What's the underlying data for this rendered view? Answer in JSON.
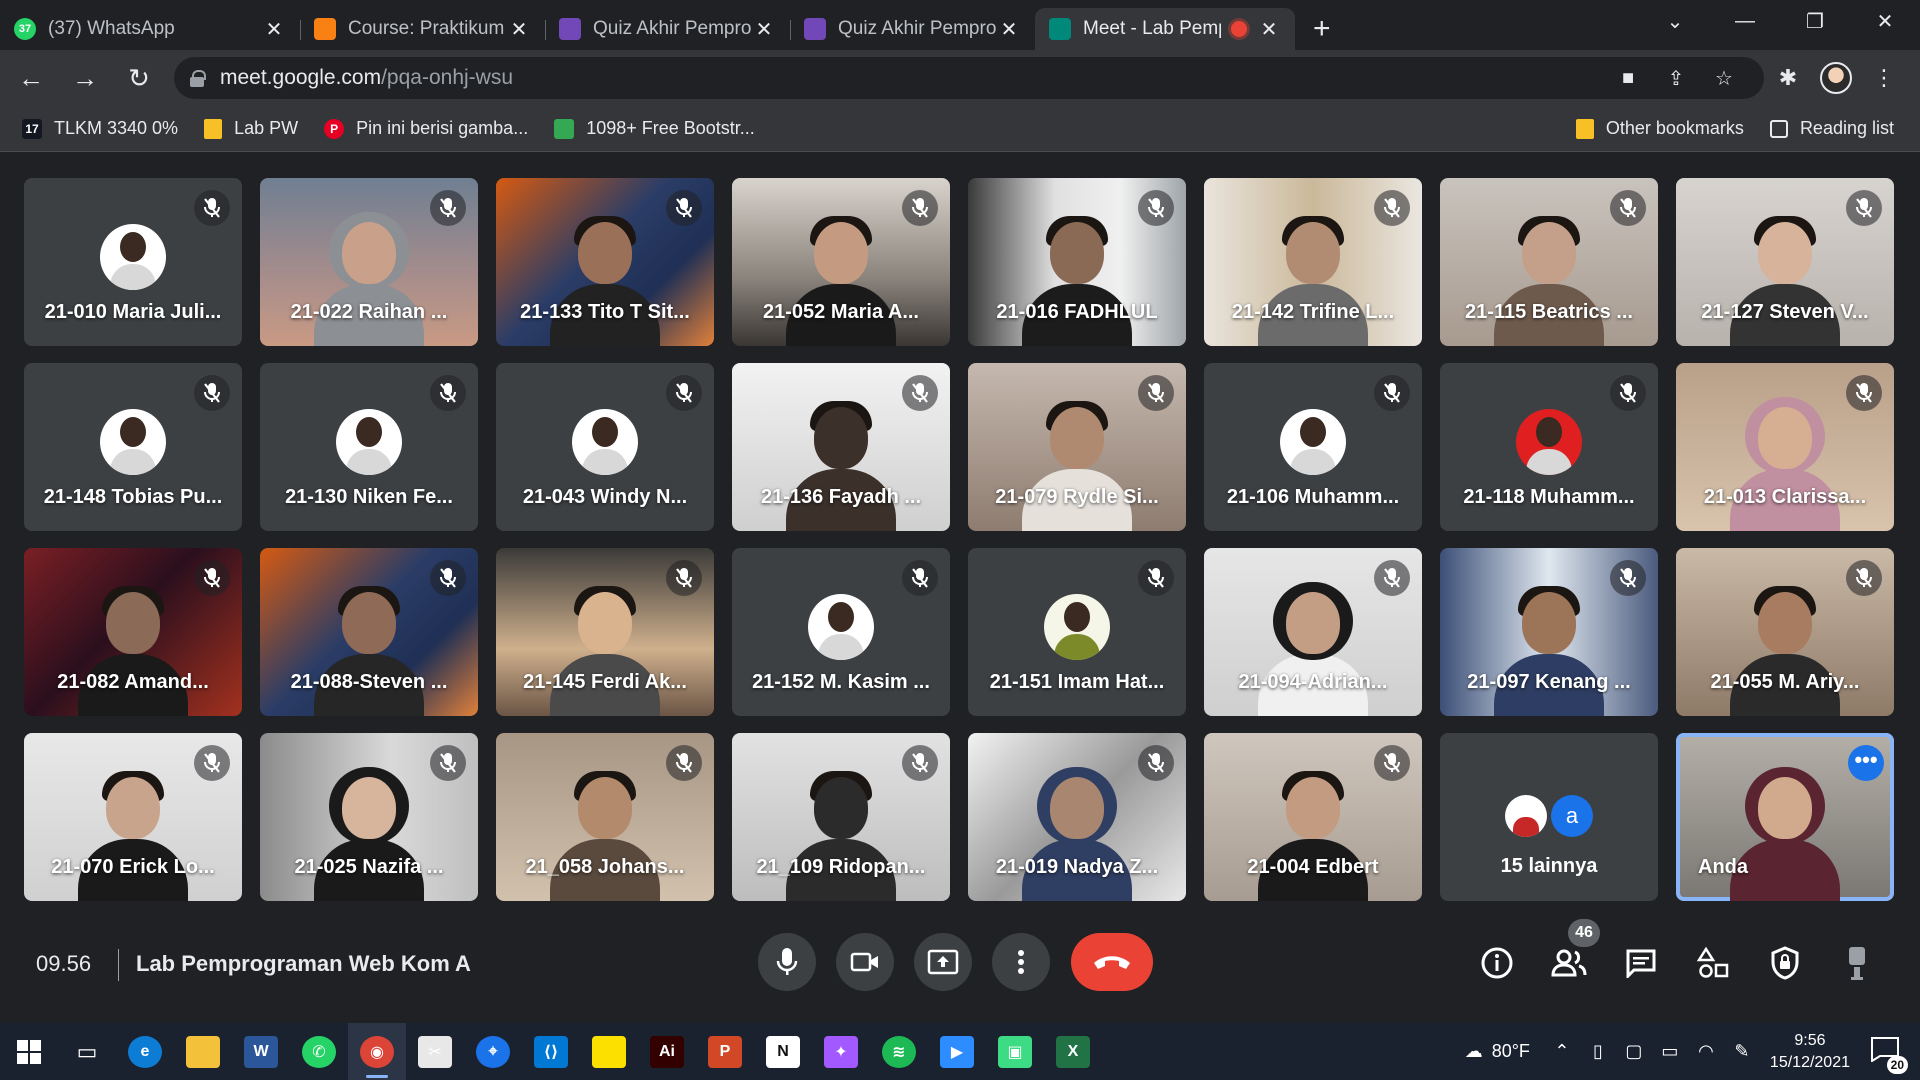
{
  "browser": {
    "tabs": [
      {
        "title": "(37) WhatsApp",
        "favicon": "whatsapp-icon",
        "color": "#25d366",
        "badge": "37",
        "active": false
      },
      {
        "title": "Course: Praktikum Pemrog",
        "favicon": "moodle-icon",
        "color": "#f98012",
        "active": false
      },
      {
        "title": "Quiz Akhir Pemprograma",
        "favicon": "forms-icon",
        "color": "#7248b9",
        "active": false
      },
      {
        "title": "Quiz Akhir Pemprograma",
        "favicon": "forms-icon",
        "color": "#7248b9",
        "active": false
      },
      {
        "title": "Meet - Lab Pemprogr",
        "favicon": "meet-icon",
        "color": "#00897b",
        "active": true,
        "recording": true
      }
    ],
    "url_host": "meet.google.com",
    "url_path": "/pqa-onhj-wsu",
    "bookmarks": [
      {
        "label": "TLKM 3340 0%",
        "icon": "tradingview-icon",
        "color": "#131722",
        "glyph": "17"
      },
      {
        "label": "Lab PW",
        "icon": "folder-icon",
        "color": "#f6c026"
      },
      {
        "label": "Pin ini berisi gamba...",
        "icon": "pinterest-icon",
        "color": "#e60023",
        "glyph": "P"
      },
      {
        "label": "1098+ Free Bootstr...",
        "icon": "leaf-icon",
        "color": "#34a853"
      }
    ],
    "other_bookmarks": "Other bookmarks",
    "reading_list": "Reading list"
  },
  "meet": {
    "tiles": [
      {
        "name": "21-010 Maria Juli...",
        "kind": "avatar",
        "bg": "#3c4043"
      },
      {
        "name": "21-022 Raihan ...",
        "kind": "video",
        "bg": "linear-gradient(180deg,#6f7f92 0%,#a38c8c 55%,#c99a84 100%)",
        "hijab": true,
        "body": "#8c8f93",
        "skin": "#c9a18a"
      },
      {
        "name": "21-133 Tito T Sit...",
        "kind": "video",
        "bg": "linear-gradient(135deg,#d55a12 0%,#2b3d66 45%,#1f2f55 70%,#e0803a 100%)",
        "body": "#222",
        "skin": "#9b7058"
      },
      {
        "name": "21-052 Maria A...",
        "kind": "video",
        "bg": "linear-gradient(180deg,#d8d3cc 0%,#8a837c 60%,#3a3633 100%)",
        "body": "#1a1a1a",
        "skin": "#c49a80"
      },
      {
        "name": "21-016 FADHLUL",
        "kind": "video",
        "bg": "linear-gradient(90deg,#3a3a3a 0%,#e0e0e0 40%,#f0f0f0 70%,#9ea4a8 100%)",
        "body": "#1c1c1c",
        "skin": "#8a6a55"
      },
      {
        "name": "21-142 Trifine L...",
        "kind": "video",
        "bg": "linear-gradient(90deg,#e9e4dc 0%,#cbb89a 50%,#eae6e0 100%)",
        "body": "#6b6b6b",
        "skin": "#b28c72"
      },
      {
        "name": "21-115 Beatrics ...",
        "kind": "video",
        "bg": "linear-gradient(180deg,#c9c3bd 0%,#a79a8f 100%)",
        "body": "#6e5a4c",
        "skin": "#c4a08a"
      },
      {
        "name": "21-127 Steven V...",
        "kind": "video",
        "bg": "linear-gradient(180deg,#d7d3cf 0%,#b8b2ac 100%)",
        "body": "#333",
        "skin": "#d8b39b"
      },
      {
        "name": "21-148 Tobias Pu...",
        "kind": "avatar",
        "bg": "#3c4043"
      },
      {
        "name": "21-130 Niken Fe...",
        "kind": "avatar",
        "bg": "#3c4043"
      },
      {
        "name": "21-043 Windy N...",
        "kind": "avatar",
        "bg": "#3c4043"
      },
      {
        "name": "21-136 Fayadh ...",
        "kind": "video",
        "bg": "linear-gradient(180deg,#f2f2f2 0%,#cfcfcf 100%)",
        "body": "#3b302a",
        "skin": "#3b302a"
      },
      {
        "name": "21-079 Rydle Si...",
        "kind": "video",
        "bg": "linear-gradient(180deg,#c5b8ae 0%,#8e7c70 100%)",
        "body": "#e5e0da",
        "skin": "#b08a70"
      },
      {
        "name": "21-106 Muhamm...",
        "kind": "avatar",
        "bg": "#3c4043"
      },
      {
        "name": "21-118 Muhamm...",
        "kind": "avatar-red",
        "bg": "#3c4043"
      },
      {
        "name": "21-013 Clarissa...",
        "kind": "video",
        "bg": "linear-gradient(180deg,#b9a089 0%,#d8c3ac 100%)",
        "hijab": true,
        "body": "#c08fa0",
        "skin": "#d6ae92"
      },
      {
        "name": "21-082 Amand...",
        "kind": "video",
        "bg": "linear-gradient(135deg,#7a1f24 0%,#2b0f1d 45%,#a3311f 100%)",
        "body": "#1a1a1a",
        "skin": "#8b6a58"
      },
      {
        "name": "21-088-Steven ...",
        "kind": "video",
        "bg": "linear-gradient(135deg,#d55a12 0%,#2b3d66 45%,#1f2f55 70%,#e0803a 100%)",
        "body": "#262626",
        "skin": "#8f6a56"
      },
      {
        "name": "21-145 Ferdi Ak...",
        "kind": "video",
        "bg": "linear-gradient(180deg,#3b3a38 0%,#cfb08d 60%,#6b5545 100%)",
        "body": "#4a4a4a",
        "skin": "#d9b28e"
      },
      {
        "name": "21-152 M. Kasim ...",
        "kind": "avatar",
        "bg": "#3c4043"
      },
      {
        "name": "21-151 Imam Hat...",
        "kind": "avatar-green",
        "bg": "#3c4043"
      },
      {
        "name": "21-094-Adrian...",
        "kind": "video",
        "bg": "linear-gradient(180deg,#e6e6e6 0%,#cfcfcf 100%)",
        "hijab": true,
        "body": "#f0f0f0",
        "skin": "#c49e84"
      },
      {
        "name": "21-097 Kenang ...",
        "kind": "video",
        "bg": "linear-gradient(90deg,#3c4f77 0%,#dfe7ef 50%,#4b5b7e 100%)",
        "body": "#2e3d63",
        "skin": "#9c7458"
      },
      {
        "name": "21-055 M. Ariy...",
        "kind": "video",
        "bg": "linear-gradient(180deg,#c9b9a6 0%,#8f7a68 100%)",
        "body": "#2a2a2a",
        "skin": "#a87c60"
      },
      {
        "name": "21-070 Erick Lo...",
        "kind": "video",
        "bg": "linear-gradient(180deg,#e8e8e8 0%,#d0d0d0 100%)",
        "body": "#1a1a1a",
        "skin": "#c9a48c"
      },
      {
        "name": "21-025 Nazifa ...",
        "kind": "video",
        "bg": "linear-gradient(90deg,#8b8b8b 0%,#d9d9d9 60%,#bfbfbf 100%)",
        "hijab": true,
        "body": "#1a1a1a",
        "skin": "#d7b49c"
      },
      {
        "name": "21_058 Johans...",
        "kind": "video",
        "bg": "linear-gradient(180deg,#a79684 0%,#d1c1ad 100%)",
        "body": "#5a4a3e",
        "skin": "#b48a6c"
      },
      {
        "name": "21_109 Ridopan...",
        "kind": "video",
        "bg": "linear-gradient(180deg,#e2e2e2 0%,#bdbdbd 100%)",
        "body": "#2b2b2b",
        "skin": "#2b2b2b"
      },
      {
        "name": "21-019 Nadya Z...",
        "kind": "video",
        "bg": "linear-gradient(135deg,#f2f2f2 0%,#9a9a9a 50%,#e8e8e8 100%)",
        "hijab": true,
        "body": "#2f3e63",
        "skin": "#a98670"
      },
      {
        "name": "21-004 Edbert",
        "kind": "video",
        "bg": "linear-gradient(180deg,#cfc6bd 0%,#a79c91 100%)",
        "body": "#1a1a1a",
        "skin": "#c39b80"
      },
      {
        "name": "15 lainnya",
        "kind": "more"
      },
      {
        "name": "Anda",
        "kind": "self",
        "bg": "linear-gradient(180deg,#b4b0a8 0%,#7a7772 100%)",
        "hijab": true,
        "body": "#5a2430",
        "skin": "#d1a98d"
      }
    ],
    "more_avatar_letter": "a",
    "clock": "09.56",
    "meeting_title": "Lab Pemprograman Web Kom A",
    "participant_count": "46",
    "self_menu_glyph": "•••"
  },
  "taskbar": {
    "apps": [
      {
        "name": "task-view-icon",
        "color": "transparent",
        "glyph": "▭"
      },
      {
        "name": "edge-icon",
        "color": "#0c7cd5",
        "glyph": "e"
      },
      {
        "name": "file-explorer-icon",
        "color": "#f3c13a",
        "glyph": ""
      },
      {
        "name": "word-icon",
        "color": "#2b579a",
        "glyph": "W"
      },
      {
        "name": "whatsapp-icon",
        "color": "#25d366",
        "glyph": "✆"
      },
      {
        "name": "chrome-icon",
        "color": "#db4437",
        "glyph": "◉",
        "active": true
      },
      {
        "name": "snip-icon",
        "color": "#e8e8e8",
        "glyph": "✂"
      },
      {
        "name": "maps-icon",
        "color": "#1a73e8",
        "glyph": "⌖"
      },
      {
        "name": "vscode-icon",
        "color": "#0078d4",
        "glyph": "⟨⟩"
      },
      {
        "name": "sticky-notes-icon",
        "color": "#fce100",
        "glyph": ""
      },
      {
        "name": "illustrator-icon",
        "color": "#330000",
        "glyph": "Ai"
      },
      {
        "name": "powerpoint-icon",
        "color": "#d24726",
        "glyph": "P"
      },
      {
        "name": "notion-icon",
        "color": "#ffffff",
        "glyph": "N"
      },
      {
        "name": "figma-icon",
        "color": "#a259ff",
        "glyph": "✦"
      },
      {
        "name": "spotify-icon",
        "color": "#1db954",
        "glyph": "≋"
      },
      {
        "name": "zoom-icon",
        "color": "#2d8cff",
        "glyph": "▶"
      },
      {
        "name": "android-icon",
        "color": "#3ddc84",
        "glyph": "▣"
      },
      {
        "name": "excel-icon",
        "color": "#217346",
        "glyph": "X"
      }
    ],
    "weather": "80°F",
    "time": "9:56",
    "date": "15/12/2021",
    "notifications": "20"
  }
}
